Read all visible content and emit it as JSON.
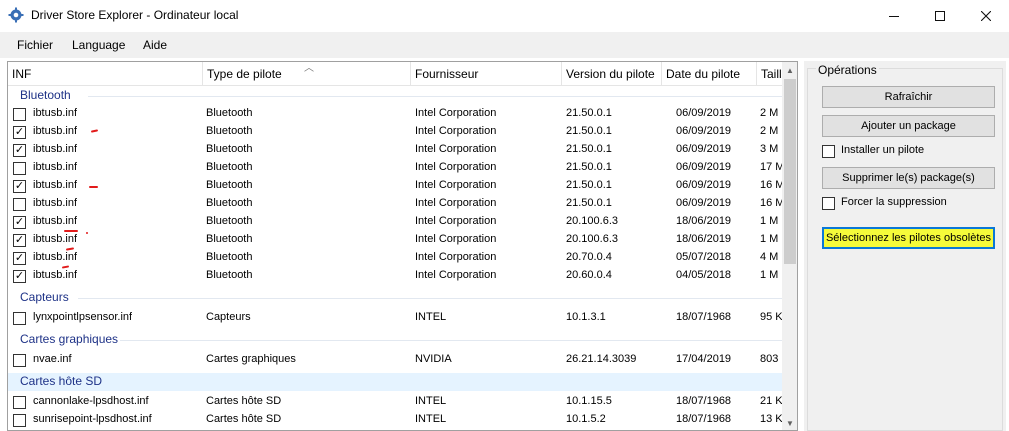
{
  "window": {
    "title": "Driver Store Explorer - Ordinateur local",
    "icon": "gear-icon"
  },
  "menu": [
    {
      "label": "Fichier"
    },
    {
      "label": "Language"
    },
    {
      "label": "Aide"
    }
  ],
  "columns": [
    {
      "label": "INF"
    },
    {
      "label": "Type de pilote"
    },
    {
      "label": "Fournisseur"
    },
    {
      "label": "Version du pilote"
    },
    {
      "label": "Date du pilote"
    },
    {
      "label": "Taill"
    }
  ],
  "groups": [
    {
      "label": "Bluetooth"
    },
    {
      "label": "Capteurs"
    },
    {
      "label": "Cartes graphiques"
    },
    {
      "label": "Cartes hôte SD"
    }
  ],
  "rows": [
    {
      "checked": false,
      "inf": "ibtusb.inf",
      "type": "Bluetooth",
      "vendor": "Intel Corporation",
      "version": "21.50.0.1",
      "date": "06/09/2019",
      "size": "2 M"
    },
    {
      "checked": true,
      "inf": "ibtusb.inf",
      "type": "Bluetooth",
      "vendor": "Intel Corporation",
      "version": "21.50.0.1",
      "date": "06/09/2019",
      "size": "2 M"
    },
    {
      "checked": true,
      "inf": "ibtusb.inf",
      "type": "Bluetooth",
      "vendor": "Intel Corporation",
      "version": "21.50.0.1",
      "date": "06/09/2019",
      "size": "3 M"
    },
    {
      "checked": false,
      "inf": "ibtusb.inf",
      "type": "Bluetooth",
      "vendor": "Intel Corporation",
      "version": "21.50.0.1",
      "date": "06/09/2019",
      "size": "17 M"
    },
    {
      "checked": true,
      "inf": "ibtusb.inf",
      "type": "Bluetooth",
      "vendor": "Intel Corporation",
      "version": "21.50.0.1",
      "date": "06/09/2019",
      "size": "16 M"
    },
    {
      "checked": false,
      "inf": "ibtusb.inf",
      "type": "Bluetooth",
      "vendor": "Intel Corporation",
      "version": "21.50.0.1",
      "date": "06/09/2019",
      "size": "16 M"
    },
    {
      "checked": true,
      "inf": "ibtusb.inf",
      "type": "Bluetooth",
      "vendor": "Intel Corporation",
      "version": "20.100.6.3",
      "date": "18/06/2019",
      "size": "1 M"
    },
    {
      "checked": true,
      "inf": "ibtusb.inf",
      "type": "Bluetooth",
      "vendor": "Intel Corporation",
      "version": "20.100.6.3",
      "date": "18/06/2019",
      "size": "1 M"
    },
    {
      "checked": true,
      "inf": "ibtusb.inf",
      "type": "Bluetooth",
      "vendor": "Intel Corporation",
      "version": "20.70.0.4",
      "date": "05/07/2018",
      "size": "4 M"
    },
    {
      "checked": true,
      "inf": "ibtusb.inf",
      "type": "Bluetooth",
      "vendor": "Intel Corporation",
      "version": "20.60.0.4",
      "date": "04/05/2018",
      "size": "1 M"
    },
    {
      "checked": false,
      "inf": "lynxpointlpsensor.inf",
      "type": "Capteurs",
      "vendor": "INTEL",
      "version": "10.1.3.1",
      "date": "18/07/1968",
      "size": "95 K"
    },
    {
      "checked": false,
      "inf": "nvae.inf",
      "type": "Cartes graphiques",
      "vendor": "NVIDIA",
      "version": "26.21.14.3039",
      "date": "17/04/2019",
      "size": "803 M"
    },
    {
      "checked": false,
      "inf": "cannonlake-lpsdhost.inf",
      "type": "Cartes hôte SD",
      "vendor": "INTEL",
      "version": "10.1.15.5",
      "date": "18/07/1968",
      "size": "21 K"
    },
    {
      "checked": false,
      "inf": "sunrisepoint-lpsdhost.inf",
      "type": "Cartes hôte SD",
      "vendor": "INTEL",
      "version": "10.1.5.2",
      "date": "18/07/1968",
      "size": "13 K"
    }
  ],
  "operations": {
    "title": "Opérations",
    "refresh_label": "Rafraîchir",
    "add_package_label": "Ajouter un package",
    "install_driver_label": "Installer un pilote",
    "delete_packages_label": "Supprimer le(s) package(s)",
    "force_delete_label": "Forcer la suppression",
    "select_obsolete_label": "Sélectionnez les pilotes obsolètes"
  },
  "colors": {
    "group_text": "#1e3287",
    "highlight_button": "#f5fb3a",
    "highlight_border": "#0a78d7",
    "annotation": "#e21b1b"
  }
}
